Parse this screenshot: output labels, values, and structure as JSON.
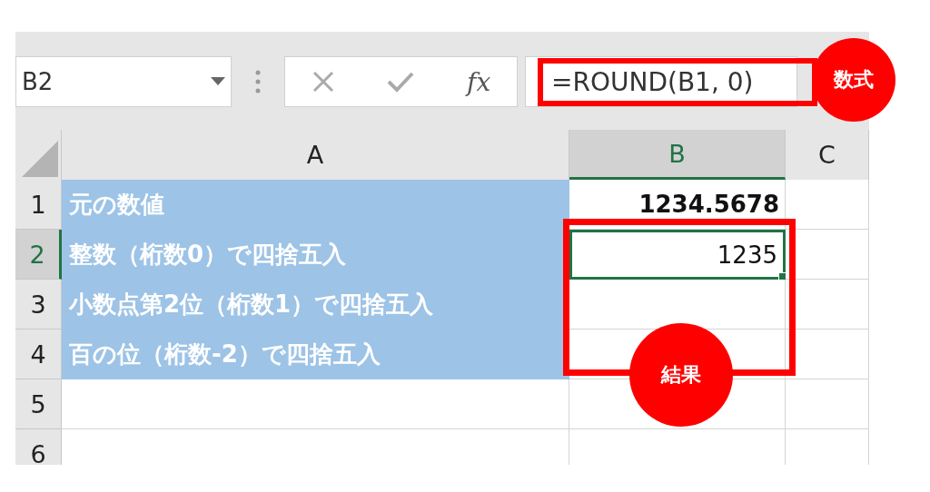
{
  "name_box": {
    "value": "B2"
  },
  "formula_bar": {
    "function_label": "fx",
    "formula": "=ROUND(B1, 0)"
  },
  "columns": [
    {
      "label": "A",
      "selected": false
    },
    {
      "label": "B",
      "selected": true
    },
    {
      "label": "C",
      "selected": false
    }
  ],
  "rows": [
    {
      "label": "1",
      "selected": false,
      "highlighted": true,
      "a": "元の数値",
      "b": {
        "text": "1234.5678",
        "bold": true
      }
    },
    {
      "label": "2",
      "selected": true,
      "highlighted": true,
      "a": "整数（桁数0）で四捨五入",
      "b": {
        "text": "1235",
        "bold": false
      }
    },
    {
      "label": "3",
      "selected": false,
      "highlighted": true,
      "a": "小数点第2位（桁数1）で四捨五入"
    },
    {
      "label": "4",
      "selected": false,
      "highlighted": true,
      "a": "百の位（桁数-2）で四捨五入"
    },
    {
      "label": "5",
      "selected": false,
      "highlighted": false
    },
    {
      "label": "6",
      "selected": false,
      "highlighted": false
    }
  ],
  "annotations": [
    {
      "text": "数式"
    },
    {
      "text": "結果"
    }
  ]
}
